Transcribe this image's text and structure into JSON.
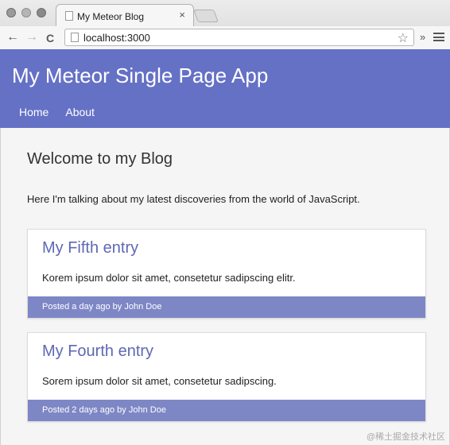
{
  "browser": {
    "tab_title": "My Meteor Blog",
    "tab_close": "×",
    "back": "←",
    "forward": "→",
    "reload": "C",
    "url": "localhost:3000",
    "star": "☆",
    "extensions": "»"
  },
  "app": {
    "title": "My Meteor Single Page App",
    "nav": [
      {
        "label": "Home"
      },
      {
        "label": "About"
      }
    ]
  },
  "main": {
    "heading": "Welcome to my Blog",
    "intro": "Here I'm talking about my latest discoveries from the world of JavaScript.",
    "posts": [
      {
        "title": "My Fifth entry",
        "body": "Korem ipsum dolor sit amet, consetetur sadipscing elitr.",
        "footer": "Posted a day ago by John Doe"
      },
      {
        "title": "My Fourth entry",
        "body": "Sorem ipsum dolor sit amet, consetetur sadipscing.",
        "footer": "Posted 2 days ago by John Doe"
      }
    ]
  },
  "watermark": "@稀土掘金技术社区"
}
